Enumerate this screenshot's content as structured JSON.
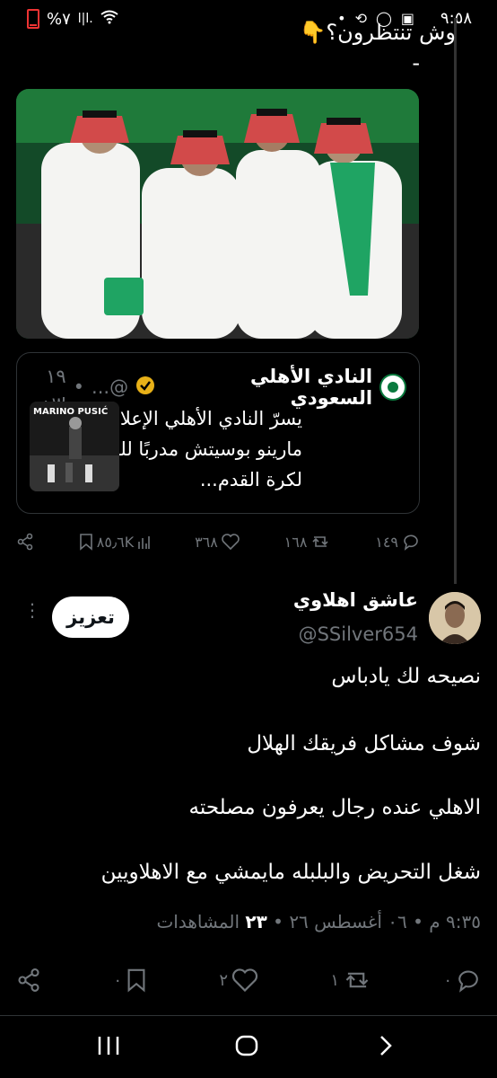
{
  "status_bar": {
    "time": "٩:٥٨",
    "battery": "%٧",
    "signal": "l|l.",
    "icons": [
      "photo-icon",
      "whatsapp-icon",
      "retweet-icon",
      "dot-icon"
    ]
  },
  "previous_tweet": {
    "text": "وش تنتظرون؟👇",
    "dash": "-"
  },
  "quoted_tweet": {
    "name": "النادي الأهلي السعودي",
    "handle": "@...",
    "time": "١٩ س",
    "separator": "•",
    "body": "يسرّ النادي الأهلي الإعلان عن تعيين مارينو بوسيتش مدربًا للفريق الأول لكرة القدم...",
    "thumbnail_caption": "MARINO PUSIĆ"
  },
  "prev_actions": {
    "replies": "١٤٩",
    "retweets": "١٦٨",
    "likes": "٣٦٨",
    "views": "٨٥٫٦K"
  },
  "reply": {
    "display_name": "عاشق اهلاوي",
    "handle": "@SSilver654",
    "boost_label": "تعزيز",
    "lines": [
      "نصيحه لك يادباس",
      "شوف مشاكل فريقك الهلال",
      "الاهلي عنده رجال يعرفون مصلحته",
      "شغل التحريض والبلبله مايمشي مع الاهلاويين"
    ],
    "meta_time": "٩:٣٥ م",
    "meta_date": "٠٦ أغسطس ٢٦",
    "meta_views": "٢٣",
    "meta_views_label": "المشاهدات",
    "separator": "•"
  },
  "reply_actions": {
    "replies": "٠",
    "retweets": "١",
    "likes": "٢",
    "bookmarks": "٠"
  },
  "nav_bar": {
    "buttons": [
      "recent-apps",
      "home",
      "back"
    ]
  }
}
